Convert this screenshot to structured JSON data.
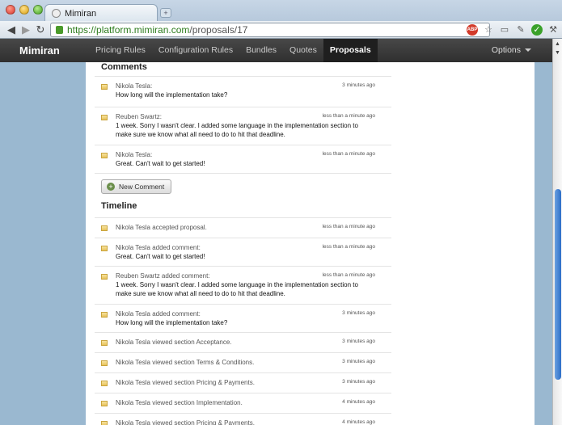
{
  "browser": {
    "tab_title": "Mimiran",
    "new_tab": "+",
    "url_host": "https://platform.mimiran.com",
    "url_path": "/proposals/17",
    "adblock_label": "ABP"
  },
  "app": {
    "brand": "Mimiran",
    "nav": [
      "Pricing Rules",
      "Configuration Rules",
      "Bundles",
      "Quotes",
      "Proposals"
    ],
    "active_nav": "Proposals",
    "options": "Options"
  },
  "comments": {
    "title": "Comments",
    "items": [
      {
        "who": "Nikola Tesla:",
        "msg": "How long will the implementation take?",
        "time": "3 minutes ago"
      },
      {
        "who": "Reuben Swartz:",
        "msg": "1 week. Sorry I wasn't clear. I added some language in the implementation section to make sure we know what all need to do to hit that deadline.",
        "time": "less than a minute ago"
      },
      {
        "who": "Nikola Tesla:",
        "msg": "Great. Can't wait to get started!",
        "time": "less than a minute ago"
      }
    ],
    "new_button": "New Comment"
  },
  "timeline": {
    "title": "Timeline",
    "items": [
      {
        "who": "Nikola Tesla accepted proposal.",
        "msg": "",
        "time": "less than a minute ago"
      },
      {
        "who": "Nikola Tesla added comment:",
        "msg": "Great. Can't wait to get started!",
        "time": "less than a minute ago"
      },
      {
        "who": "Reuben Swartz added comment:",
        "msg": "1 week. Sorry I wasn't clear. I added some language in the implementation section to make sure we know what all need to do to hit that deadline.",
        "time": "less than a minute ago"
      },
      {
        "who": "Nikola Tesla added comment:",
        "msg": "How long will the implementation take?",
        "time": "3 minutes ago"
      },
      {
        "who": "Nikola Tesla viewed section Acceptance.",
        "msg": "",
        "time": "3 minutes ago"
      },
      {
        "who": "Nikola Tesla viewed section Terms & Conditions.",
        "msg": "",
        "time": "3 minutes ago"
      },
      {
        "who": "Nikola Tesla viewed section Pricing & Payments.",
        "msg": "",
        "time": "3 minutes ago"
      },
      {
        "who": "Nikola Tesla viewed section Implementation.",
        "msg": "",
        "time": "4 minutes ago"
      },
      {
        "who": "Nikola Tesla viewed section Pricing & Payments.",
        "msg": "",
        "time": "4 minutes ago"
      }
    ]
  }
}
